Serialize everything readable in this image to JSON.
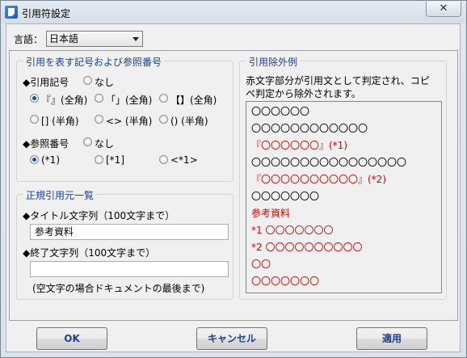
{
  "window": {
    "title": "引用符設定",
    "close_glyph": "✕"
  },
  "language": {
    "label": "言語：",
    "selected": "日本語"
  },
  "group_mark": {
    "title": "引用を表す記号および参照番号",
    "quote_label": "◆引用記号",
    "quote_none": "なし",
    "quote_options": [
      "『』(全角)",
      "「」(全角)",
      "【】(全角)",
      "[] (半角)",
      "<> (半角)",
      "() (半角)"
    ],
    "quote_selected": 0,
    "ref_label": "◆参照番号",
    "ref_none": "なし",
    "ref_options": [
      "(*1)",
      "[*1]",
      "<*1>"
    ],
    "ref_selected": 0
  },
  "group_regex": {
    "title": "正規引用元一覧",
    "title_label": "◆タイトル文字列（100文字まで）",
    "title_value": "参考資料",
    "end_label": "◆終了文字列（100文字まで）",
    "end_value": "",
    "note": "(空文字の場合ドキュメントの最後まで)"
  },
  "group_exclude": {
    "title": "引用除外例",
    "desc_line1": "赤文字部分が引用文として判定され、コピ",
    "desc_line2": "ペ判定から除外されます。",
    "sample_lines": [
      {
        "text": "〇〇〇〇〇〇",
        "red": false
      },
      {
        "text": "〇〇〇〇〇〇〇〇〇〇〇〇",
        "red": false
      },
      {
        "text": "『〇〇〇〇〇〇』(*1)",
        "red": true
      },
      {
        "text": "〇〇〇〇〇〇〇〇〇〇〇〇〇〇〇〇",
        "red": false
      },
      {
        "text": "『〇〇〇〇〇〇〇〇〇〇』(*2)",
        "red": true
      },
      {
        "text": "〇〇〇〇〇〇〇",
        "red": false
      },
      {
        "text": "参考資料",
        "red": true
      },
      {
        "text": "*1 〇〇〇〇〇〇〇",
        "red": true
      },
      {
        "text": "*2 〇〇〇〇〇〇〇〇〇〇",
        "red": true
      },
      {
        "text": "〇〇",
        "red": true
      },
      {
        "text": "〇〇〇〇〇〇〇",
        "red": true
      }
    ]
  },
  "buttons": {
    "ok": "OK",
    "cancel": "キャンセル",
    "apply": "適用"
  }
}
